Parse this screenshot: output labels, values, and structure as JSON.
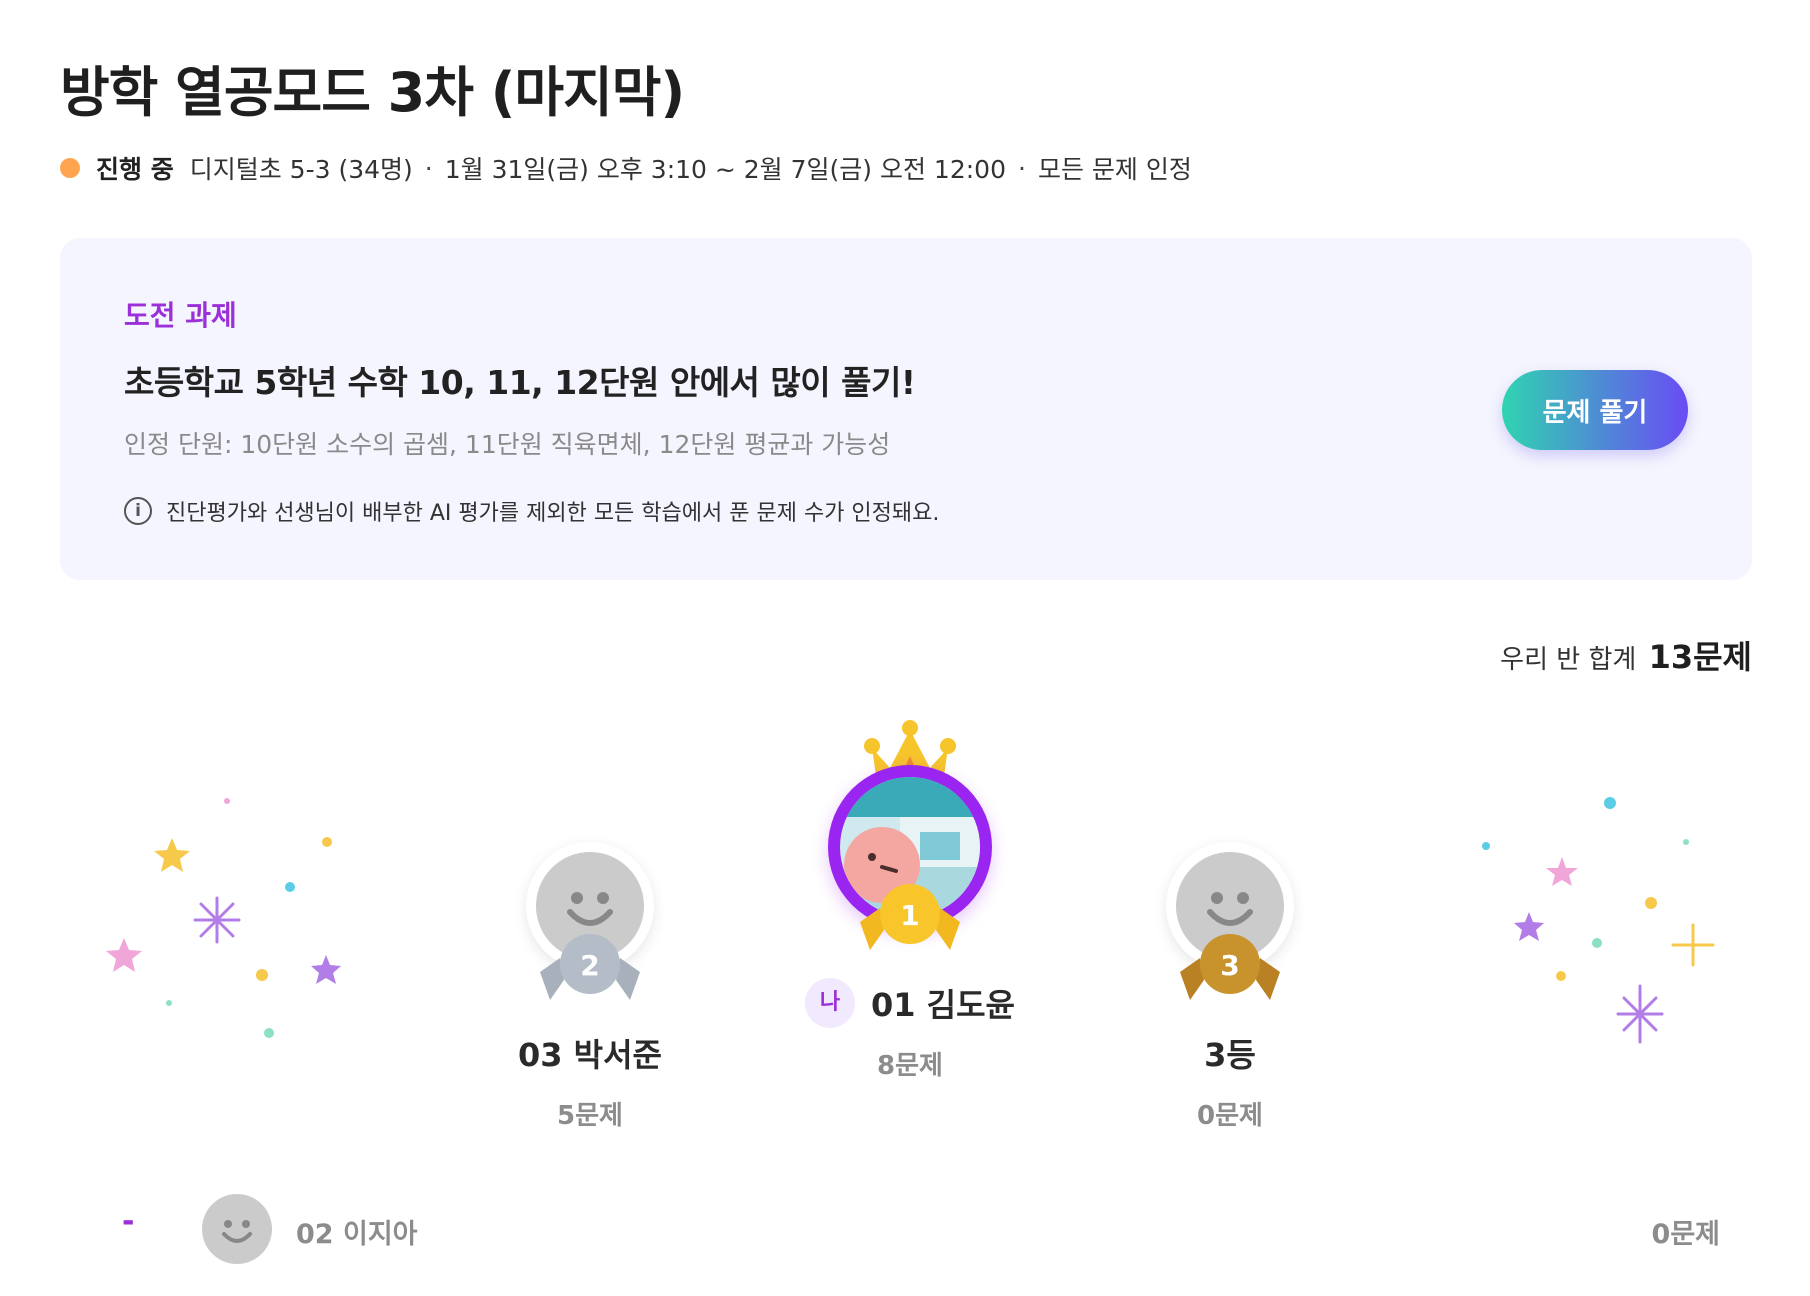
{
  "page": {
    "title": "방학 열공모드 3차 (마지막)"
  },
  "meta": {
    "status": "진행 중",
    "status_color": "#ffa54f",
    "class_info": "디지털초 5-3 (34명)",
    "period": "1월 31일(금) 오후 3:10 ~ 2월 7일(금) 오전 12:00",
    "recognition": "모든 문제 인정",
    "separator": "·"
  },
  "challenge": {
    "label": "도전 과제",
    "title": "초등학교 5학년 수학 10, 11, 12단원 안에서 많이 풀기!",
    "units": "인정 단원: 10단원 소수의 곱셈, 11단원 직육면체, 12단원 평균과 가능성",
    "info_icon": "info-circle-icon",
    "info": "진단평가와 선생님이 배부한 AI 평가를 제외한 모든 학습에서 푼 문제 수가 인정돼요.",
    "button_label": "문제 풀기",
    "button_gradient": [
      "#2fd4b0",
      "#6a4bf5"
    ]
  },
  "summary": {
    "label": "우리 반 합계",
    "value": "13문제"
  },
  "podium": {
    "first": {
      "rank": "1",
      "name": "01 김도윤",
      "count": "8문제",
      "me_badge": "나",
      "ring_color": "#9a24f0",
      "medal_color": "#f5c227"
    },
    "second": {
      "rank": "2",
      "name": "03 박서준",
      "count": "5문제",
      "medal_color": "#a8b0bc"
    },
    "third": {
      "rank": "3",
      "name": "3등",
      "count": "0문제",
      "medal_color": "#c8922d"
    }
  },
  "list": [
    {
      "rank": "-",
      "name": "02 이지아",
      "count": "0문제"
    }
  ]
}
